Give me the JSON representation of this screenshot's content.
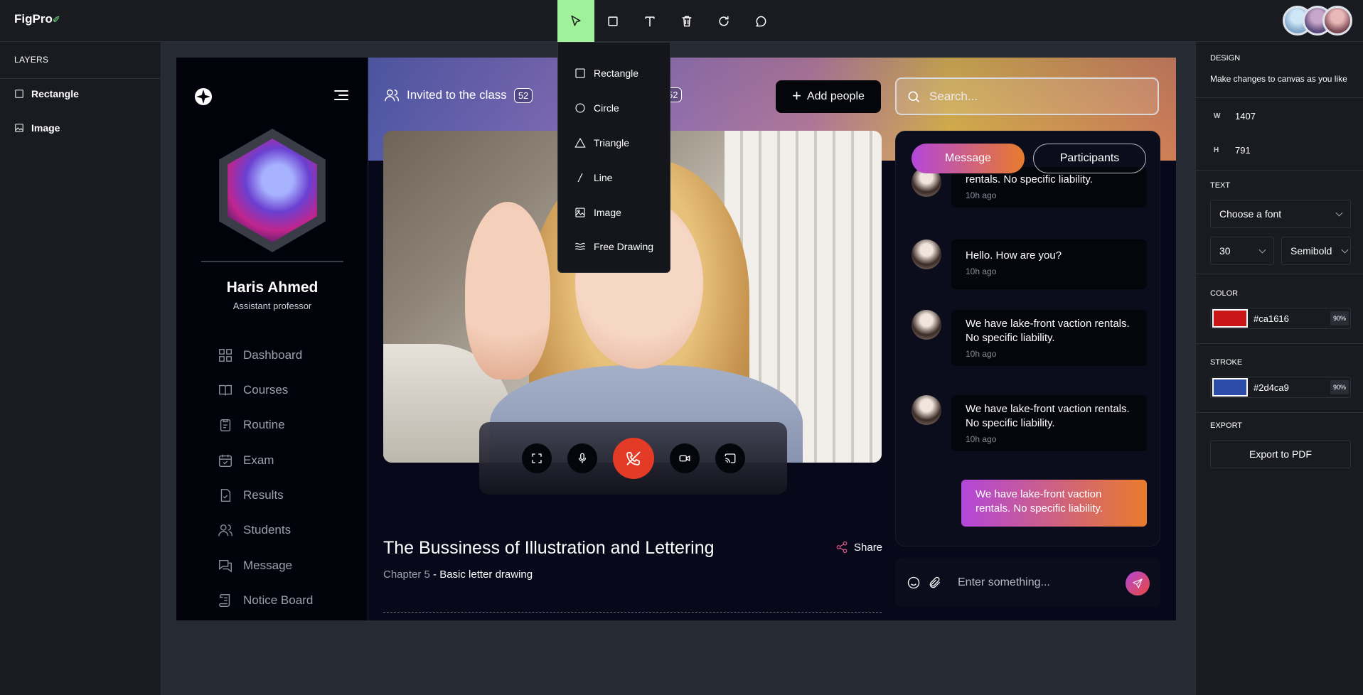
{
  "app": {
    "logo": "FigPro",
    "logo_mark": "✐"
  },
  "toolbar": {
    "tools": [
      "select",
      "rectangle",
      "text",
      "delete",
      "redo",
      "comment"
    ],
    "active": "select"
  },
  "shape_menu": {
    "items": [
      "Rectangle",
      "Circle",
      "Triangle",
      "Line",
      "Image",
      "Free Drawing"
    ]
  },
  "layers": {
    "heading": "LAYERS",
    "items": [
      "Rectangle",
      "Image"
    ]
  },
  "design": {
    "heading": "DESIGN",
    "subtitle": "Make changes to canvas as you like",
    "w_label": "W",
    "w_value": "1407",
    "h_label": "H",
    "h_value": "791",
    "text_heading": "TEXT",
    "font_placeholder": "Choose a font",
    "font_size": "30",
    "font_weight": "Semibold",
    "color_heading": "COLOR",
    "color_hex": "#ca1616",
    "color_opacity": "90%",
    "stroke_heading": "STROKE",
    "stroke_hex": "#2d4ca9",
    "stroke_opacity": "90%",
    "export_heading": "EXPORT",
    "export_label": "Export to PDF"
  },
  "colors": {
    "accent_green": "#9ff19a",
    "fill": "#ca1616",
    "stroke": "#2d4ca9",
    "end_call": "#e43b26"
  },
  "design_canvas": {
    "profile": {
      "name": "Haris Ahmed",
      "role": "Assistant professor"
    },
    "nav": [
      "Dashboard",
      "Courses",
      "Routine",
      "Exam",
      "Results",
      "Students",
      "Message",
      "Notice Board"
    ],
    "invited_label": "Invited to the class",
    "invited_count": "52",
    "second_count": "52",
    "add_people": "Add people",
    "search_placeholder": "Search...",
    "course_title": "The Bussiness of Illustration and Lettering",
    "share_label": "Share",
    "chapter": "Chapter 5",
    "chapter_sub": " - Basic letter drawing",
    "chat": {
      "tab_message": "Message",
      "tab_participants": "Participants",
      "messages": [
        {
          "text": "rentals. No specific liability.",
          "time": "10h ago"
        },
        {
          "text": "Hello. How are you?",
          "time": "10h ago"
        },
        {
          "text": "We have lake-front vaction rentals. No specific liability.",
          "time": "10h ago"
        },
        {
          "text": "We have lake-front vaction rentals. No specific liability.",
          "time": "10h ago"
        }
      ],
      "outgoing": "We have lake-front vaction rentals. No specific liability.",
      "input_placeholder": "Enter something..."
    }
  }
}
